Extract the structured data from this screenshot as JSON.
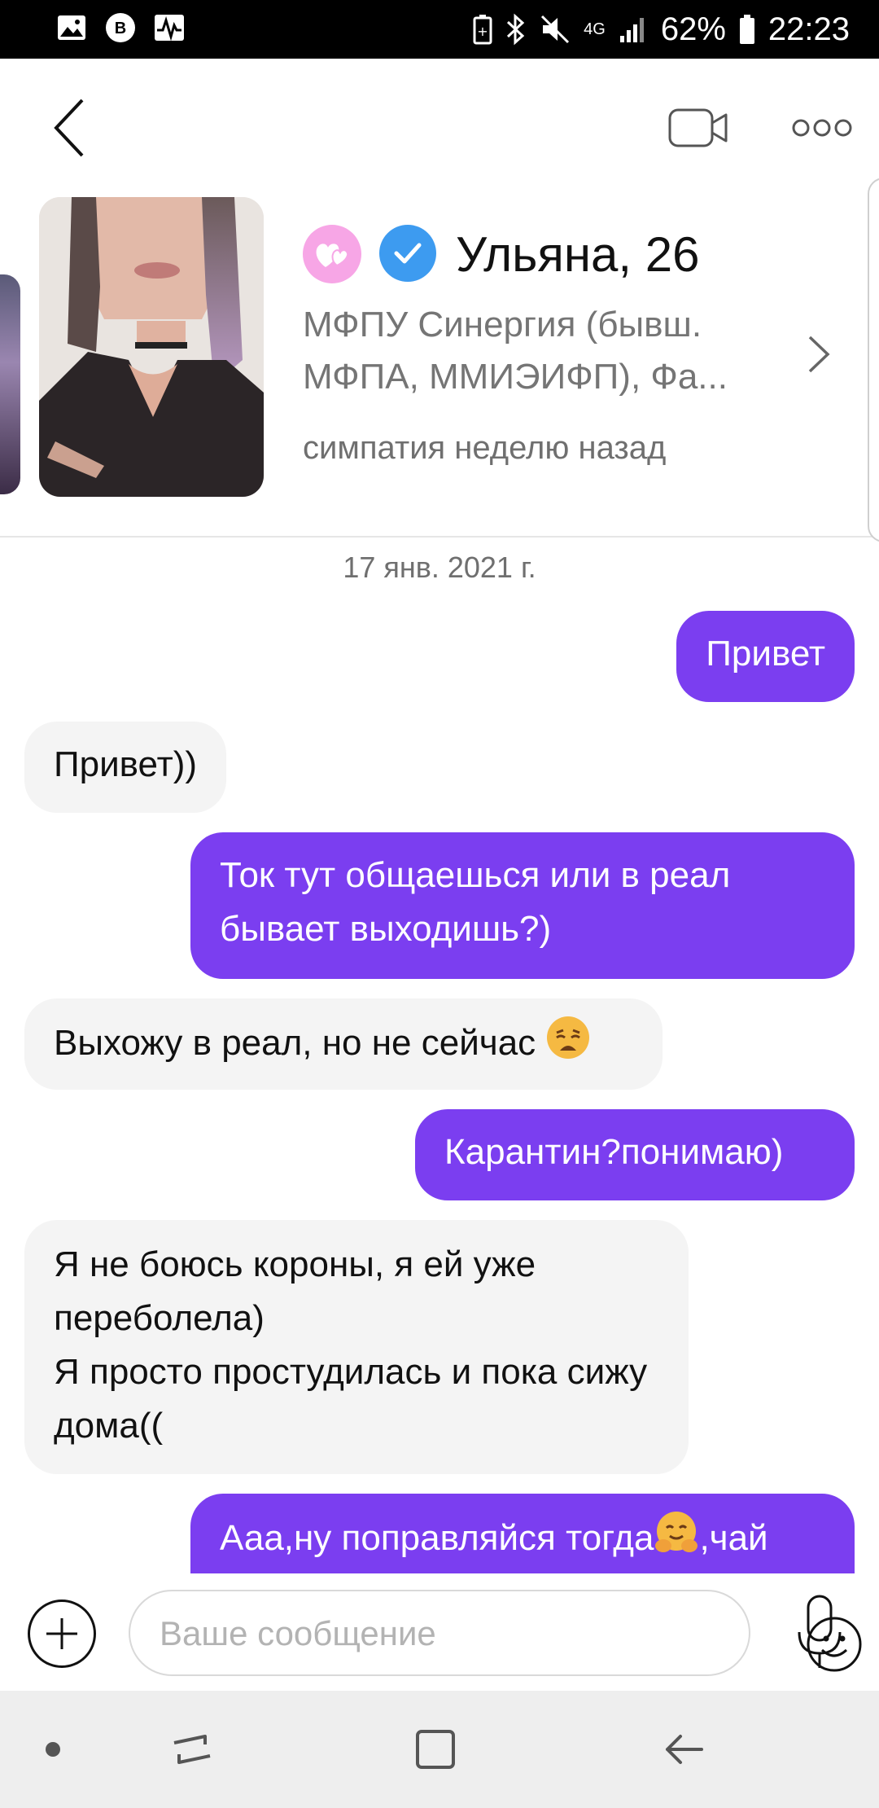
{
  "status_bar": {
    "network": "4G",
    "battery": "62%",
    "time": "22:23",
    "left_icons": [
      "gallery-icon",
      "vk-icon",
      "activity-icon"
    ],
    "right_icons": [
      "battery-saver-icon",
      "bluetooth-icon",
      "mute-icon",
      "network-icon",
      "signal-icon",
      "battery-icon"
    ]
  },
  "header": {
    "back_icon": "back-chevron-icon",
    "video_icon": "video-call-icon",
    "more_icon": "more-options-icon"
  },
  "profile": {
    "name": "Ульяна, 26",
    "school_line1": "МФПУ Синергия (бывш.",
    "school_line2": "МФПА, ММИЭИФП), Фа...",
    "sympathy": "симпатия неделю назад",
    "badges": [
      "match-hearts-icon",
      "verified-check-icon"
    ]
  },
  "chat": {
    "date": "17 янв. 2021 г.",
    "messages": [
      {
        "dir": "out",
        "text": "Привет"
      },
      {
        "dir": "in",
        "text": "Привет))"
      },
      {
        "dir": "out",
        "text": "Ток тут общаешься или в реал бывает выходишь?)"
      },
      {
        "dir": "in",
        "text": "Выхожу в реал, но не сейчас",
        "emoji": "weary-face-emoji"
      },
      {
        "dir": "out",
        "text": "Карантин?понимаю)"
      },
      {
        "dir": "in",
        "text_lines": [
          "Я не боюсь короны, я ей уже переболела)",
          "Я просто простудилась и пока сижу дома(("
        ]
      },
      {
        "dir": "out",
        "text_before": "Ааа,ну поправляйся тогда",
        "emoji": "hugging-face-emoji",
        "text_after": ",чай"
      }
    ]
  },
  "composer": {
    "placeholder": "Ваше сообщение",
    "add_icon": "plus-icon",
    "emoji_icon": "smiley-icon",
    "mic_icon": "microphone-icon"
  },
  "colors": {
    "accent": "#7b3ef0",
    "incoming_bubble": "#f4f4f4",
    "verified": "#3d9bf0",
    "match_badge": "#f7a6e6"
  }
}
